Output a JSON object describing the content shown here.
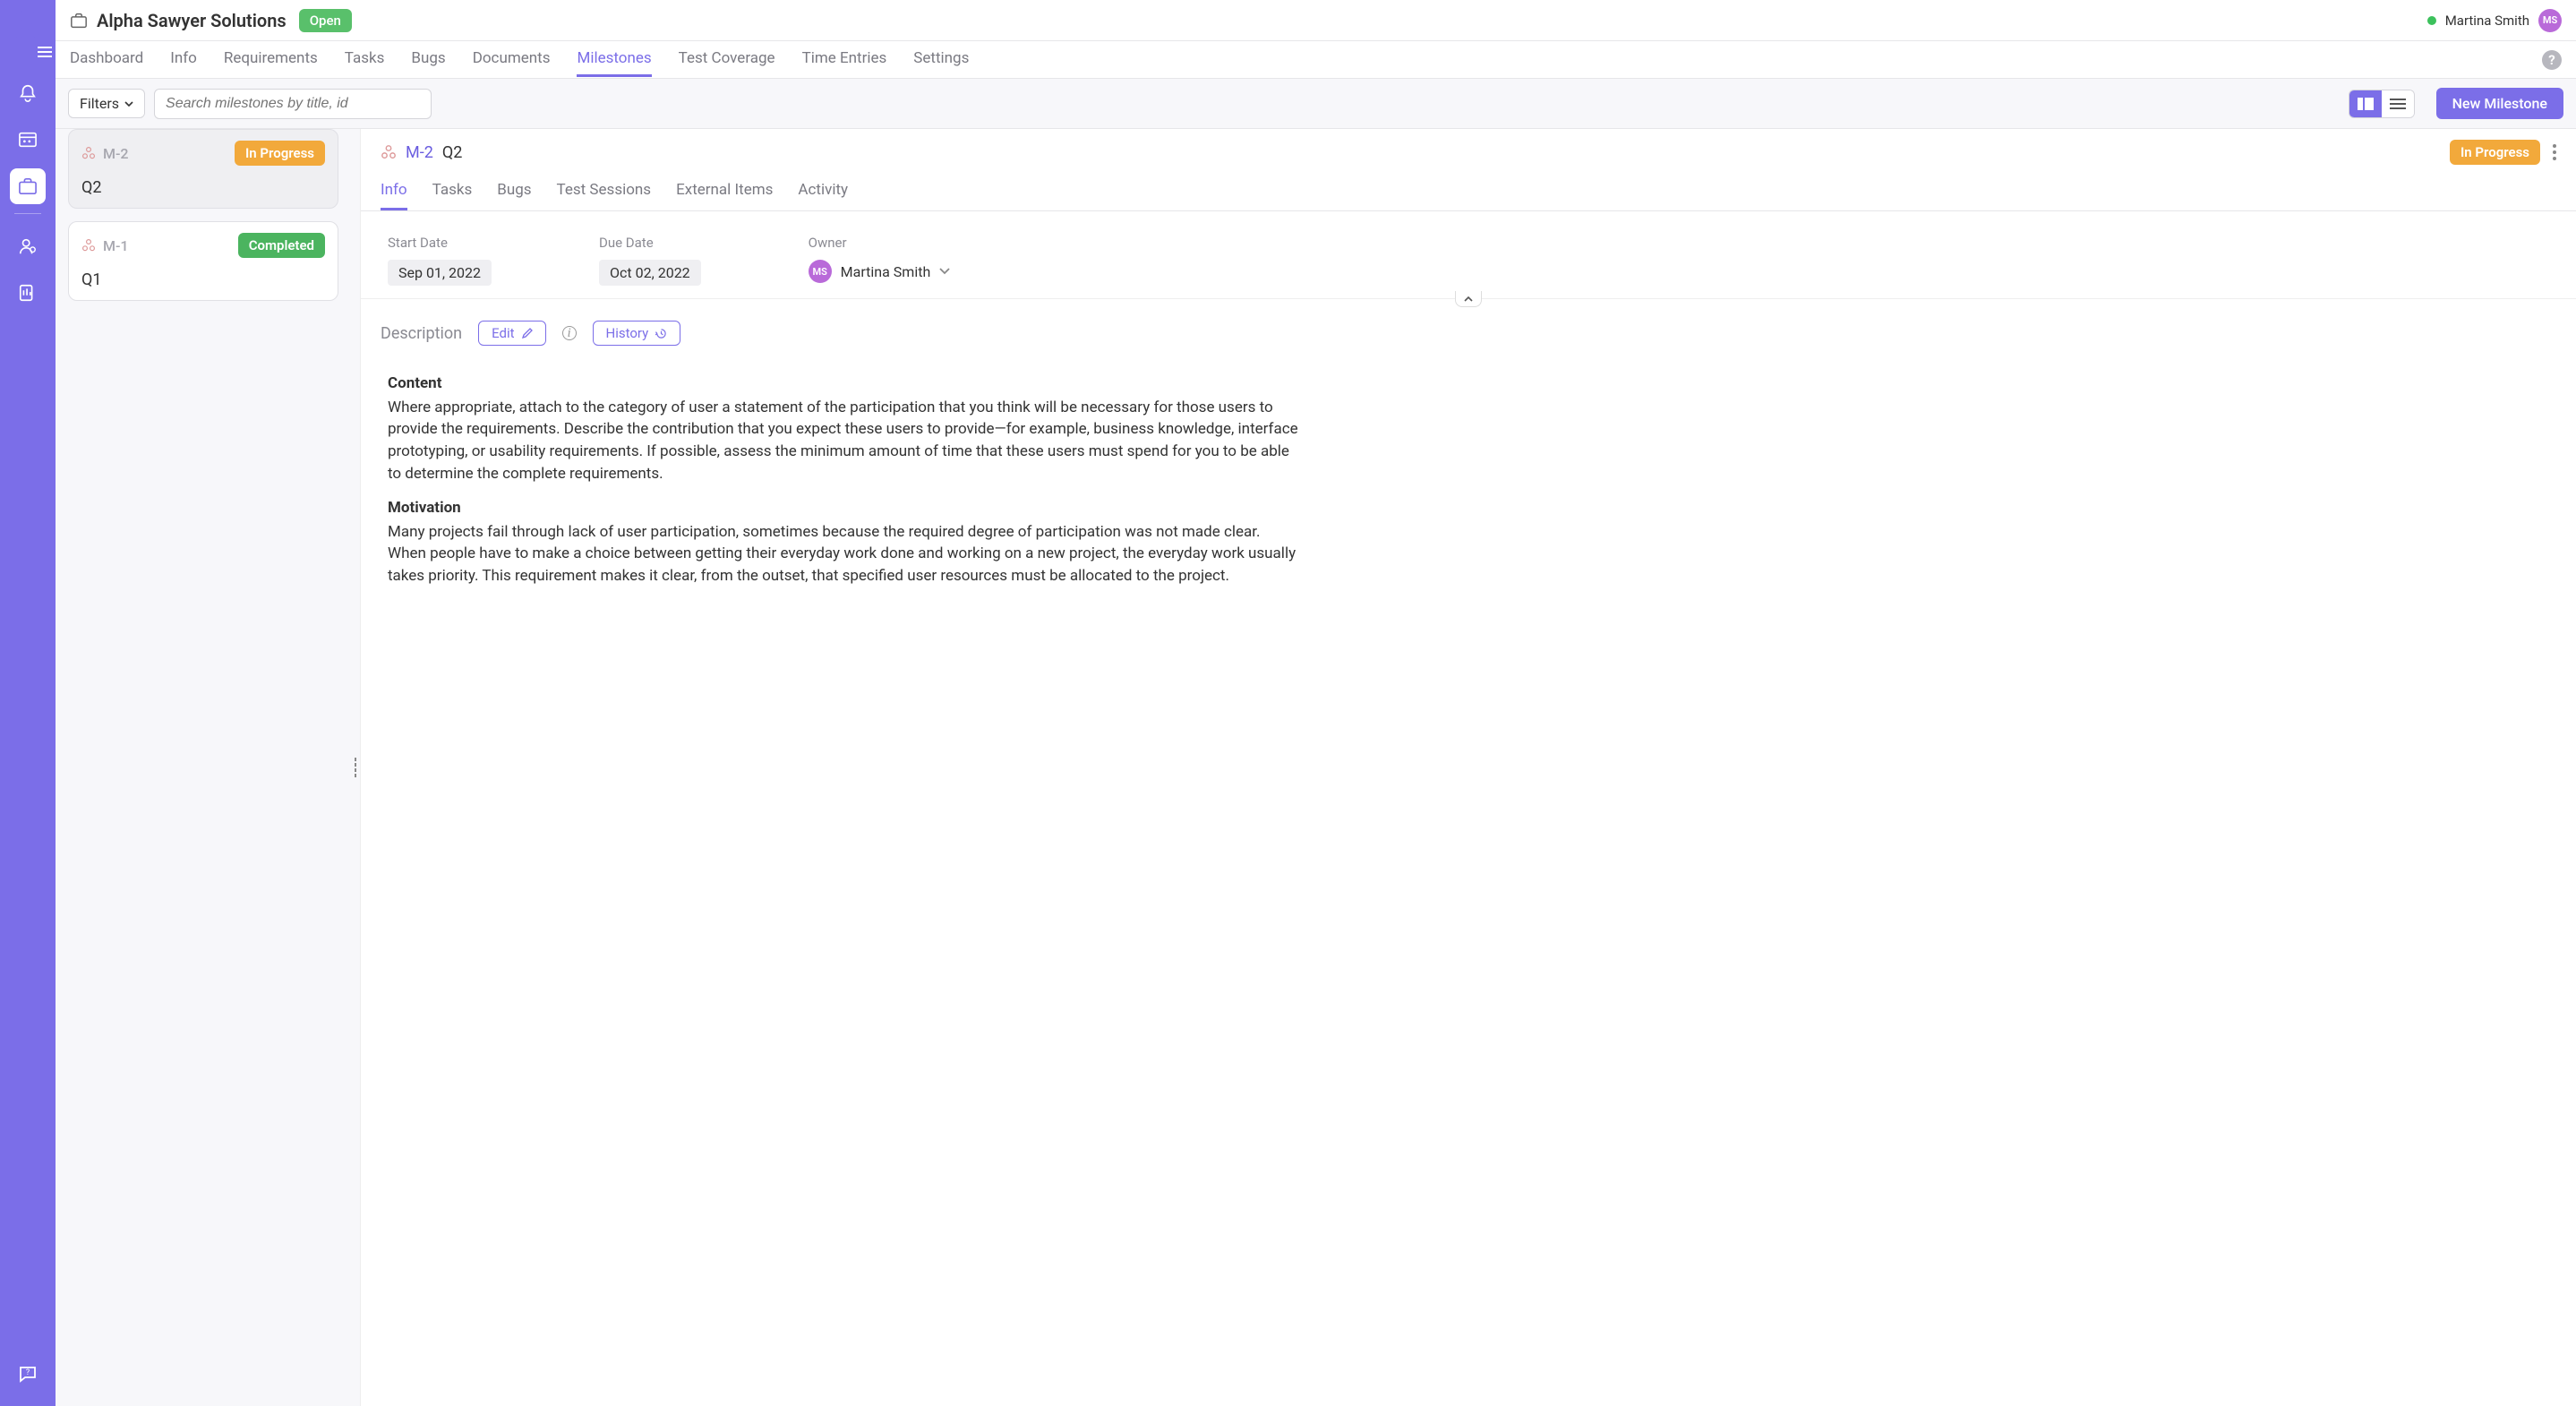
{
  "project": {
    "name": "Alpha Sawyer Solutions",
    "status": "Open"
  },
  "current_user": {
    "name": "Martina Smith",
    "initials": "MS"
  },
  "main_tabs": {
    "dashboard": "Dashboard",
    "info": "Info",
    "requirements": "Requirements",
    "tasks": "Tasks",
    "bugs": "Bugs",
    "documents": "Documents",
    "milestones": "Milestones",
    "test_coverage": "Test Coverage",
    "time_entries": "Time Entries",
    "settings": "Settings"
  },
  "toolbar": {
    "filters_label": "Filters",
    "search_placeholder": "Search milestones by title, id",
    "new_label": "New Milestone"
  },
  "milestones": [
    {
      "id": "M-2",
      "title": "Q2",
      "status": "In Progress",
      "status_kind": "progress",
      "selected": true
    },
    {
      "id": "M-1",
      "title": "Q1",
      "status": "Completed",
      "status_kind": "completed",
      "selected": false
    }
  ],
  "detail": {
    "breadcrumb_id": "M-2",
    "breadcrumb_title": "Q2",
    "status": "In Progress",
    "tabs": {
      "info": "Info",
      "tasks": "Tasks",
      "bugs": "Bugs",
      "test_sessions": "Test Sessions",
      "external_items": "External Items",
      "activity": "Activity"
    },
    "start_date": {
      "label": "Start Date",
      "value": "Sep 01, 2022"
    },
    "due_date": {
      "label": "Due Date",
      "value": "Oct 02, 2022"
    },
    "owner": {
      "label": "Owner",
      "name": "Martina Smith",
      "initials": "MS"
    },
    "description": {
      "label": "Description",
      "edit_label": "Edit",
      "history_label": "History",
      "h1": "Content",
      "p1": "Where appropriate, attach to the category of user a statement of the participation that you think will be necessary for those users to provide the requirements. Describe the contribution that you expect these users to provide—for example, business knowledge, interface prototyping, or usability requirements. If possible, assess the minimum amount of time that these users must spend for you to be able to determine the complete requirements.",
      "h2": "Motivation",
      "p2": "Many projects fail through lack of user participation, sometimes because the required degree of participation was not made clear. When people have to make a choice between getting their everyday work done and working on a new project, the everyday work usually takes priority. This requirement makes it clear, from the outset, that specified user resources must be allocated to the project."
    }
  },
  "colors": {
    "primary": "#7b6ee8",
    "progress": "#f2a93b",
    "completed": "#4bb45f",
    "open": "#59c06b"
  }
}
